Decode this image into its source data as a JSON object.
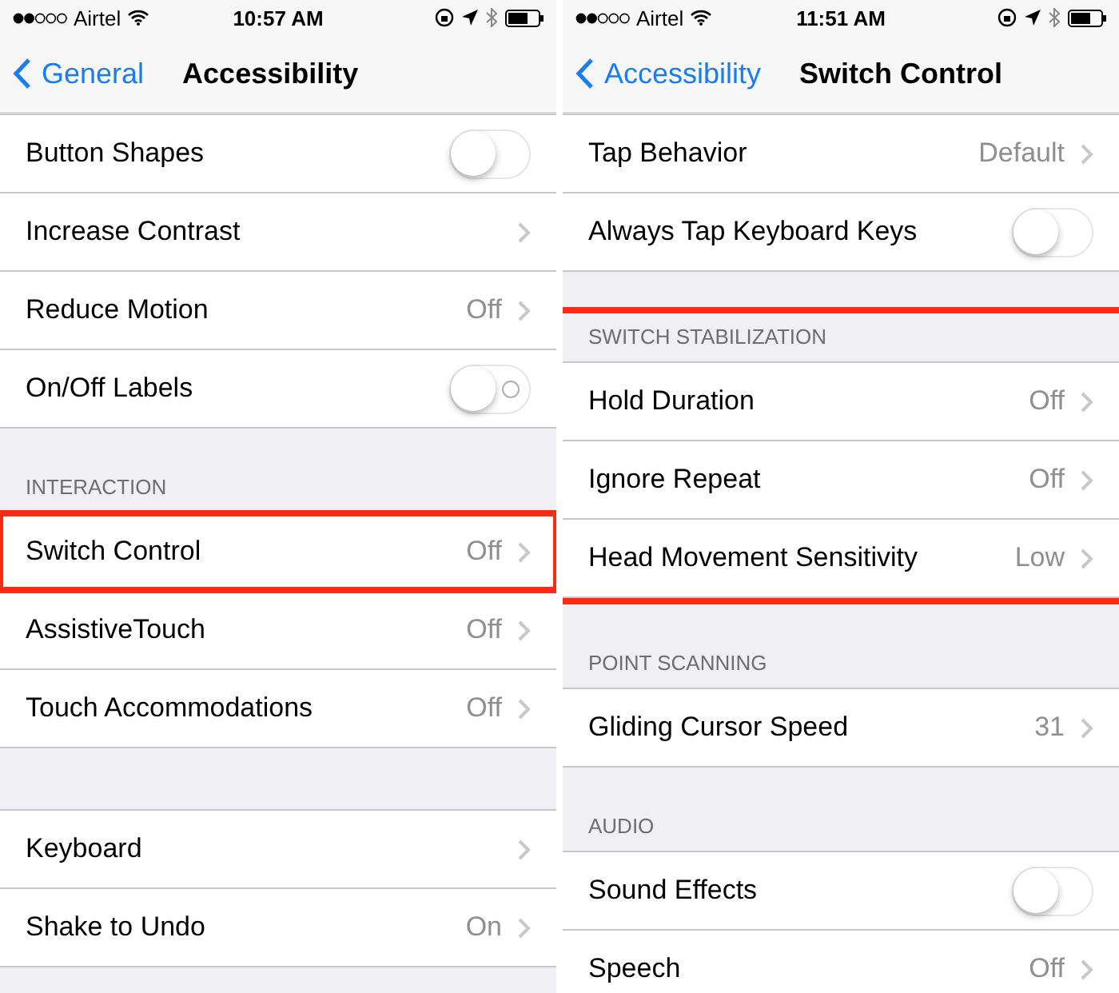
{
  "panels": [
    {
      "status": {
        "carrier": "Airtel",
        "time": "10:57 AM"
      },
      "nav": {
        "back": "General",
        "title": "Accessibility"
      },
      "sections": [
        {
          "highlighted": false,
          "rows": [
            {
              "label": "Button Shapes",
              "kind": "toggle",
              "on": false,
              "labels": false,
              "highlighted": false
            },
            {
              "label": "Increase Contrast",
              "kind": "link",
              "highlighted": false
            },
            {
              "label": "Reduce Motion",
              "kind": "link",
              "value": "Off",
              "highlighted": false
            },
            {
              "label": "On/Off Labels",
              "kind": "toggle",
              "on": false,
              "labels": true,
              "highlighted": false
            }
          ]
        },
        {
          "header": "INTERACTION",
          "highlighted": false,
          "rows": [
            {
              "label": "Switch Control",
              "kind": "link",
              "value": "Off",
              "highlighted": true
            },
            {
              "label": "AssistiveTouch",
              "kind": "link",
              "value": "Off",
              "highlighted": false
            },
            {
              "label": "Touch Accommodations",
              "kind": "link",
              "value": "Off",
              "highlighted": false
            }
          ]
        },
        {
          "highlighted": false,
          "rows": [
            {
              "label": "Keyboard",
              "kind": "link",
              "highlighted": false
            },
            {
              "label": "Shake to Undo",
              "kind": "link",
              "value": "On",
              "highlighted": false
            }
          ]
        }
      ]
    },
    {
      "status": {
        "carrier": "Airtel",
        "time": "11:51 AM"
      },
      "nav": {
        "back": "Accessibility",
        "title": "Switch Control"
      },
      "sections": [
        {
          "highlighted": false,
          "rows": [
            {
              "label": "Tap Behavior",
              "kind": "link",
              "value": "Default",
              "highlighted": false
            },
            {
              "label": "Always Tap Keyboard Keys",
              "kind": "toggle",
              "on": false,
              "labels": false,
              "highlighted": false
            }
          ]
        },
        {
          "header": "SWITCH STABILIZATION",
          "highlighted": true,
          "rows": [
            {
              "label": "Hold Duration",
              "kind": "link",
              "value": "Off",
              "highlighted": false
            },
            {
              "label": "Ignore Repeat",
              "kind": "link",
              "value": "Off",
              "highlighted": false
            },
            {
              "label": "Head Movement Sensitivity",
              "kind": "link",
              "value": "Low",
              "highlighted": false
            }
          ]
        },
        {
          "header": "POINT SCANNING",
          "highlighted": false,
          "rows": [
            {
              "label": "Gliding Cursor Speed",
              "kind": "link",
              "value": "31",
              "highlighted": false
            }
          ]
        },
        {
          "header": "AUDIO",
          "highlighted": false,
          "rows": [
            {
              "label": "Sound Effects",
              "kind": "toggle",
              "on": false,
              "labels": false,
              "highlighted": false
            },
            {
              "label": "Speech",
              "kind": "link",
              "value": "Off",
              "highlighted": false
            }
          ]
        }
      ]
    }
  ]
}
